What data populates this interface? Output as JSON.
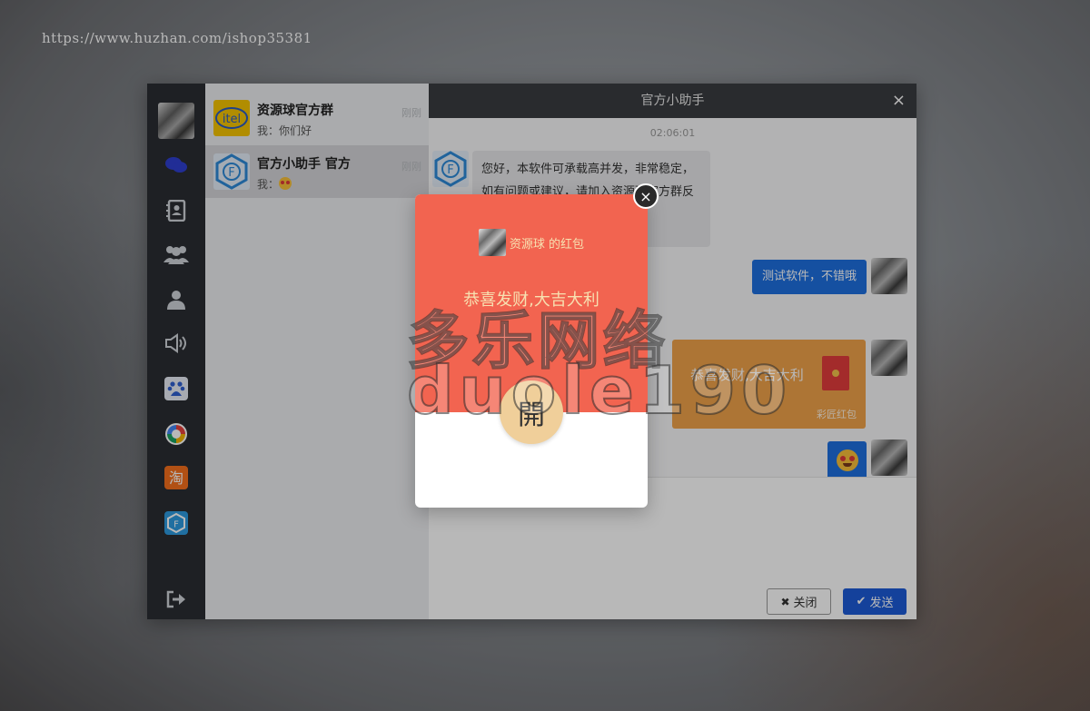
{
  "url": "https://www.huzhan.com/ishop35381",
  "sidebar": {
    "icons": [
      "chat-icon",
      "contacts-icon",
      "group-icon",
      "user-icon",
      "speaker-icon",
      "baidu-icon",
      "baidu-net-icon",
      "taobao-icon",
      "official-assistant-icon",
      "logout-icon"
    ]
  },
  "conversations": [
    {
      "name": "资源球官方群",
      "last": "我：你们好",
      "time": "刚刚",
      "avatar_text": "itel"
    },
    {
      "name": "官方小助手 官方",
      "last": "我：",
      "time": "刚刚",
      "avatar_text": "F"
    }
  ],
  "chat": {
    "title": "官方小助手",
    "close": "×",
    "timestamp": "02:06:01",
    "welcome_message": "您好，本软件可承载高并发，非常稳定，如有问题或建议，请加入资源球官方群反馈您的意见和建议。",
    "outgoing_text": "测试软件，不错哦",
    "red_packet_wish": "恭喜发财,大吉大利",
    "red_packet_label": "彩匠红包",
    "close_button": "关闭",
    "send_button": "发送"
  },
  "red_packet_modal": {
    "sender": "资源球 的红包",
    "wish": "恭喜发财,大吉大利",
    "open_label": "開",
    "close": "×"
  },
  "watermark": {
    "line1": "多乐网络",
    "line2": "duole190"
  },
  "colors": {
    "sidebar": "#2a2d33",
    "header": "#3a3c40",
    "blue_bubble": "#1e6fe0",
    "red_packet": "#f0a24a",
    "modal_red": "#f26450",
    "open_button": "#f0cf9a"
  }
}
